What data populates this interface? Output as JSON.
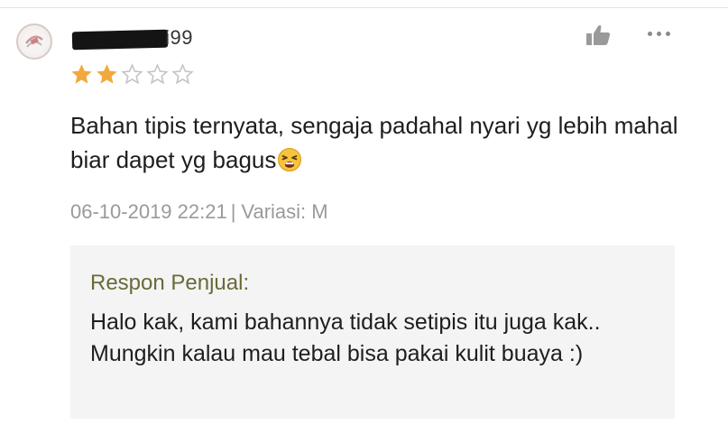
{
  "review": {
    "username_visible_suffix": "i99",
    "rating": {
      "value": 2,
      "max": 5,
      "filled_color": "#f2a93b",
      "empty_color": "#c9c9c9"
    },
    "text_part1": "Bahan tipis ternyata, sengaja padahal nyari yg lebih mahal biar dapet yg bagus",
    "text_emoji": "tired-face-emoji",
    "date": "06-10-2019 22:21",
    "separator": "|",
    "variation": "Variasi: M",
    "icons": {
      "like": "thumbs-up-icon",
      "more": "more-options-icon",
      "avatar": "avatar-icon"
    }
  },
  "seller_response": {
    "title": "Respon Penjual:",
    "text": "Halo kak, kami bahannya tidak setipis itu juga kak.. Mungkin kalau mau tebal bisa pakai kulit buaya :)"
  },
  "colors": {
    "accent_star": "#f2a93b",
    "response_bg": "#f4f4f4",
    "response_title": "#6a6a3a"
  }
}
